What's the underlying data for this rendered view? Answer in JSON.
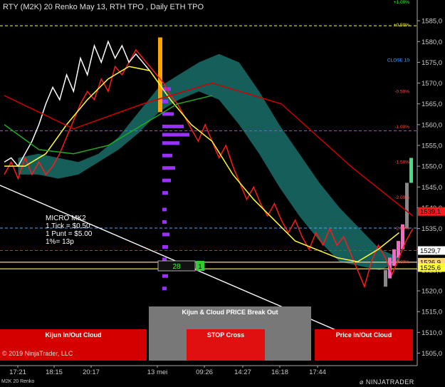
{
  "header": {
    "title": "RTY (M2K) 20 Renko  May 13, RTH TPO , Daily ETH TPO"
  },
  "info_box": {
    "lines": [
      "MICRO MK2",
      "1 Tick = $0.50",
      "1 Punt = $5.00",
      "1%= 13p"
    ]
  },
  "copyright": "© 2019 NinjaTrader, LLC",
  "footer_label": "M2K 20 Renko",
  "logo_text": "NINJATRADER",
  "buttons": {
    "kijun_inout": "Kijun In/Out Cloud",
    "kijun_cloud_breakout": "Kijun & Cloud PRICE Break Out",
    "stop_cross": "STOP Cross",
    "price_inout": "Price In/Out Cloud"
  },
  "counter_box": {
    "value": "28",
    "marker": "1"
  },
  "colors": {
    "background": "#000000",
    "price_line_red": "#ff1a1a",
    "price_line_white": "#ffffff",
    "kijun_yellow": "#ffff33",
    "cloud_teal": "#1a6e68",
    "tpo_purple": "#9b30ff",
    "tpo_pink": "#ff66cc",
    "button_red": "#d40000",
    "button_gray": "#777777"
  },
  "chart_data": {
    "type": "line",
    "title": "RTY (M2K) 20 Renko  May 13, RTH TPO , Daily ETH TPO",
    "ylim": [
      1502,
      1590
    ],
    "y_ticks": [
      1505,
      1510,
      1515,
      1520,
      1525,
      1530,
      1535,
      1540,
      1545,
      1550,
      1555,
      1560,
      1565,
      1570,
      1575,
      1580,
      1585
    ],
    "x_ticks": [
      "17:21",
      "18:15",
      "20:17",
      "13 mei",
      "09:26",
      "14:27",
      "16:18",
      "17:44"
    ],
    "price_labels": [
      {
        "value": "1539,1",
        "color": "#ff1a1a"
      },
      {
        "value": "1529,7",
        "color": "#ffffff"
      },
      {
        "value": "1526,9",
        "color": "#ffd27f"
      },
      {
        "value": "1525,6",
        "color": "#ffff33"
      }
    ],
    "pct_labels": [
      {
        "text": "+1,00%",
        "color": "#33ff33",
        "y": 1589.5
      },
      {
        "text": "+0.50%",
        "color": "#ffff33",
        "y": 1584
      },
      {
        "text": "CLOSE 10",
        "color": "#4da6ff",
        "y": 1575.5
      },
      {
        "text": "-0.50%",
        "color": "#ff4d4d",
        "y": 1568
      },
      {
        "text": "-1.00%",
        "color": "#ff4d4d",
        "y": 1559.5
      },
      {
        "text": "-1.50%",
        "color": "#ff4d4d",
        "y": 1551
      },
      {
        "text": "-2.00%",
        "color": "#ff4d4d",
        "y": 1542.5
      },
      {
        "text": "-2.50%",
        "color": "#ff4d4d",
        "y": 1535
      },
      {
        "text": "-3.00%",
        "color": "#ff4d4d",
        "y": 1527
      }
    ],
    "series": [
      {
        "name": "",
        "color": "#ff1a1a",
        "x": [
          0,
          1,
          2,
          3,
          4,
          5,
          6,
          7,
          8,
          9,
          10,
          11,
          12,
          13,
          14,
          15,
          16,
          17,
          18,
          19,
          20,
          21,
          22,
          23,
          24,
          25,
          26,
          27,
          28,
          29,
          30,
          31,
          32,
          33,
          34,
          35,
          36,
          37,
          38,
          39,
          40,
          41,
          42,
          43,
          44,
          45,
          46,
          47,
          48,
          49,
          50,
          51,
          52,
          53,
          54,
          55,
          56,
          57,
          58,
          59
        ],
        "values": [
          1548,
          1551,
          1547,
          1552,
          1548,
          1551,
          1548,
          1550,
          1553,
          1557,
          1561,
          1565,
          1568,
          1566,
          1571,
          1568,
          1574,
          1572,
          1575,
          1578,
          1576,
          1574,
          1572,
          1570,
          1567,
          1565,
          1562,
          1559,
          1556,
          1560,
          1556,
          1552,
          1555,
          1550,
          1546,
          1542,
          1545,
          1541,
          1538,
          1541,
          1537,
          1534,
          1537,
          1533,
          1530,
          1534,
          1531,
          1535,
          1531,
          1533,
          1529,
          1525,
          1521,
          1527,
          1531,
          1528,
          1524,
          1528,
          1532,
          1535
        ]
      },
      {
        "name": "",
        "color": "#ffffff",
        "x": [
          0,
          1,
          2,
          3,
          4,
          5,
          6,
          7,
          8,
          9,
          10,
          11,
          12,
          13,
          14,
          15,
          16,
          17,
          18,
          19,
          20,
          21
        ],
        "values": [
          1551,
          1552,
          1550,
          1553,
          1556,
          1560,
          1565,
          1569,
          1566,
          1572,
          1568,
          1576,
          1572,
          1579,
          1575,
          1580,
          1576,
          1579,
          1575,
          1577,
          1575,
          1573
        ]
      },
      {
        "name": "",
        "color": "#ffff33",
        "x": [
          0,
          3,
          6,
          9,
          12,
          15,
          18,
          21,
          24,
          27,
          30,
          33,
          36,
          39,
          42,
          45,
          48,
          51,
          54,
          57
        ],
        "values": [
          1550,
          1550,
          1553,
          1560,
          1566,
          1571,
          1574,
          1573,
          1566,
          1560,
          1556,
          1548,
          1542,
          1537,
          1532,
          1530,
          1528,
          1527,
          1530,
          1534
        ]
      },
      {
        "name": "",
        "color": "#22aa22",
        "x": [
          0,
          5,
          10,
          15,
          20,
          25,
          30
        ],
        "values": [
          1560,
          1554,
          1553,
          1555,
          1560,
          1565,
          1567
        ]
      },
      {
        "name": "",
        "color": "#cc0000",
        "x": [
          0,
          10,
          20,
          30,
          40,
          50,
          59
        ],
        "values": [
          1567,
          1559,
          1565,
          1570,
          1565,
          1550,
          1538
        ]
      }
    ],
    "horizontal_lines": [
      {
        "y": 1583.8,
        "color": "#ffff33",
        "style": "dashed"
      },
      {
        "y": 1558.5,
        "color": "#cc33ff",
        "style": "dashed"
      },
      {
        "y": 1535.1,
        "color": "#4da6ff",
        "style": "dashed"
      },
      {
        "y": 1529.7,
        "color": "#ff1a1a",
        "style": "dashed"
      },
      {
        "y": 1526.9,
        "color": "#ffd27f",
        "style": "solid"
      },
      {
        "y": 1525.3,
        "color": "#ffff33",
        "style": "solid"
      }
    ],
    "grid": false
  }
}
